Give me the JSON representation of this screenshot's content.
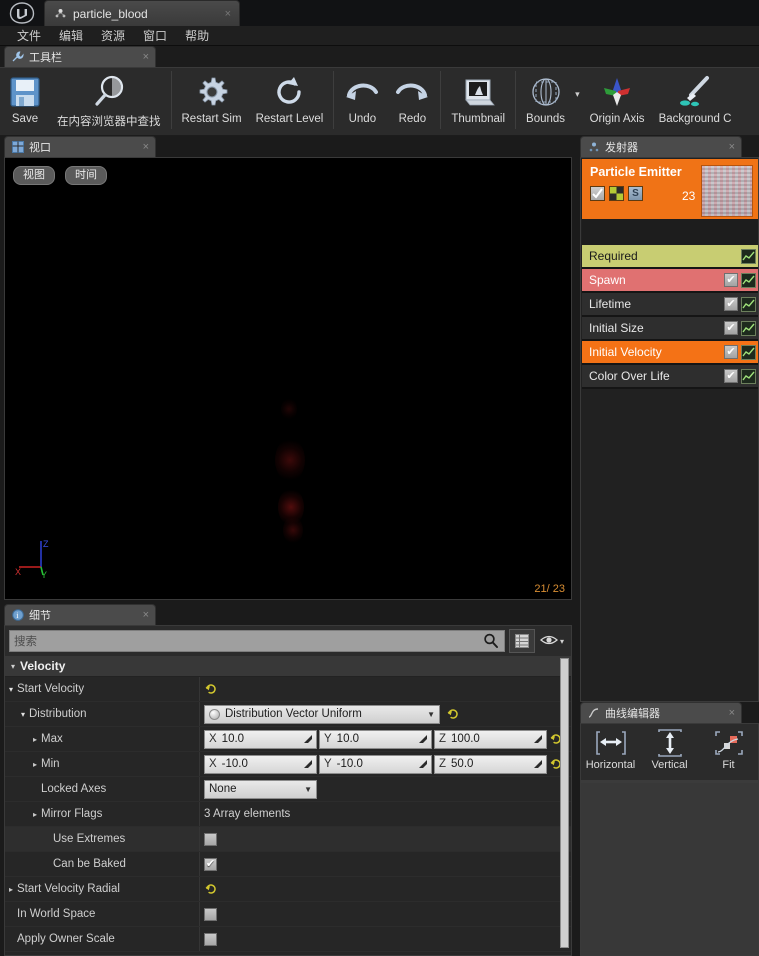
{
  "window": {
    "logo": "ue-logo",
    "tab": {
      "title": "particle_blood",
      "icon": "particle-icon",
      "close": "×"
    }
  },
  "menubar": {
    "items": [
      {
        "label": "文件"
      },
      {
        "label": "编辑"
      },
      {
        "label": "资源"
      },
      {
        "label": "窗口"
      },
      {
        "label": "帮助"
      }
    ]
  },
  "toolbar": {
    "tab": {
      "label": "工具栏",
      "icon": "wrench-icon",
      "close": "×"
    },
    "items": [
      {
        "label": "Save",
        "icon": "save-icon",
        "name": "save"
      },
      {
        "label": "在内容浏览器中查找",
        "icon": "magnifier-icon",
        "name": "find-in-content-browser"
      },
      {
        "sep": true
      },
      {
        "label": "Restart Sim",
        "icon": "gear-icon",
        "name": "restart-sim"
      },
      {
        "label": "Restart Level",
        "icon": "refresh-icon",
        "name": "restart-level"
      },
      {
        "sep": true
      },
      {
        "label": "Undo",
        "icon": "undo-arrow-icon",
        "name": "undo"
      },
      {
        "label": "Redo",
        "icon": "redo-arrow-icon",
        "name": "redo"
      },
      {
        "sep": true
      },
      {
        "label": "Thumbnail",
        "icon": "thumbnail-icon",
        "name": "thumbnail"
      },
      {
        "sep": true
      },
      {
        "label": "Bounds",
        "icon": "bounds-icon",
        "name": "bounds",
        "caret": "▾"
      },
      {
        "label": "Origin Axis",
        "icon": "origin-axis-icon",
        "name": "origin-axis"
      },
      {
        "label": "Background C",
        "icon": "background-color-icon",
        "name": "background-color"
      }
    ]
  },
  "viewport": {
    "tab": {
      "label": "视口",
      "icon": "viewport-icon",
      "close": "×"
    },
    "buttons": [
      {
        "label": "视图",
        "name": "view"
      },
      {
        "label": "时间",
        "name": "time"
      }
    ],
    "gizmo": {
      "x": "X",
      "y": "Y",
      "z": "Z"
    },
    "counter": "21/ 23"
  },
  "emitter_panel": {
    "tab": {
      "label": "发射器",
      "icon": "emitter-icon",
      "close": "×"
    },
    "emitter": {
      "name": "Particle Emitter",
      "count": "23",
      "header_color": "#f07316",
      "mini_icons": [
        "enable-emitter-icon",
        "render-mode-icon",
        "solo-mode-icon"
      ],
      "thumbnail": "emitter-thumbnail"
    },
    "modules": [
      {
        "label": "Required",
        "bg": "#c8cd72",
        "fg": "#1a1a1a",
        "checkbox": false,
        "graph": true
      },
      {
        "label": "Spawn",
        "bg": "#e07171",
        "fg": "#ffffff",
        "checkbox": true,
        "graph": true
      },
      {
        "label": "Lifetime",
        "bg": "#2e2e2e",
        "fg": "#e8e8e8",
        "checkbox": true,
        "graph": true
      },
      {
        "label": "Initial Size",
        "bg": "#2e2e2e",
        "fg": "#e8e8e8",
        "checkbox": true,
        "graph": true
      },
      {
        "label": "Initial Velocity",
        "bg": "#f47216",
        "fg": "#ffffff",
        "checkbox": true,
        "graph": true
      },
      {
        "label": "Color Over Life",
        "bg": "#2e2e2e",
        "fg": "#e8e8e8",
        "checkbox": true,
        "graph": true
      }
    ]
  },
  "curve_editor": {
    "tab": {
      "label": "曲线编辑器",
      "icon": "curve-icon",
      "close": "×"
    },
    "buttons": [
      {
        "label": "Horizontal",
        "icon": "fit-horizontal-icon",
        "name": "fit-horizontal"
      },
      {
        "label": "Vertical",
        "icon": "fit-vertical-icon",
        "name": "fit-vertical"
      },
      {
        "label": "Fit",
        "icon": "fit-all-icon",
        "name": "fit-all"
      }
    ]
  },
  "details": {
    "tab": {
      "label": "细节",
      "icon": "details-icon",
      "close": "×"
    },
    "search": {
      "placeholder": "搜索",
      "value": "",
      "icon": "search-icon"
    },
    "toolbar_icons": [
      "grid-view-icon",
      "eye-icon"
    ],
    "category": {
      "label": "Velocity",
      "arrow": "◢"
    },
    "rows": [
      {
        "name": "Start Velocity",
        "indent": 0,
        "tri": "open",
        "type": "reset"
      },
      {
        "name": "Distribution",
        "indent": 1,
        "tri": "open",
        "type": "combo",
        "combo": "Distribution Vector Uniform",
        "reset": true
      },
      {
        "name": "Max",
        "indent": 2,
        "tri": "closed",
        "type": "vector",
        "vector": [
          {
            "axis": "X",
            "value": "10.0"
          },
          {
            "axis": "Y",
            "value": "10.0"
          },
          {
            "axis": "Z",
            "value": "100.0"
          }
        ],
        "reset": true
      },
      {
        "name": "Min",
        "indent": 2,
        "tri": "closed",
        "type": "vector",
        "vector": [
          {
            "axis": "X",
            "value": "-10.0"
          },
          {
            "axis": "Y",
            "value": "-10.0"
          },
          {
            "axis": "Z",
            "value": "50.0"
          }
        ],
        "reset": true
      },
      {
        "name": "Locked Axes",
        "indent": 2,
        "tri": "none",
        "type": "select",
        "select": "None"
      },
      {
        "name": "Mirror Flags",
        "indent": 2,
        "tri": "closed",
        "type": "text",
        "text": "3 Array elements"
      },
      {
        "name": "Use Extremes",
        "indent": 3,
        "tri": "none",
        "type": "checkbox",
        "checked": false,
        "alt": true
      },
      {
        "name": "Can be Baked",
        "indent": 3,
        "tri": "none",
        "type": "checkbox",
        "checked": true
      },
      {
        "name": "Start Velocity Radial",
        "indent": 0,
        "tri": "closed",
        "type": "reset"
      },
      {
        "name": "In World Space",
        "indent": 1,
        "tri": "none",
        "type": "checkbox",
        "checked": false
      },
      {
        "name": "Apply Owner Scale",
        "indent": 1,
        "tri": "none",
        "type": "checkbox",
        "checked": false
      }
    ]
  },
  "colors": {
    "accent_orange": "#f07316",
    "spawn_red": "#e07171",
    "required_olive": "#c8cd72",
    "counter_orange": "#d98e33"
  }
}
